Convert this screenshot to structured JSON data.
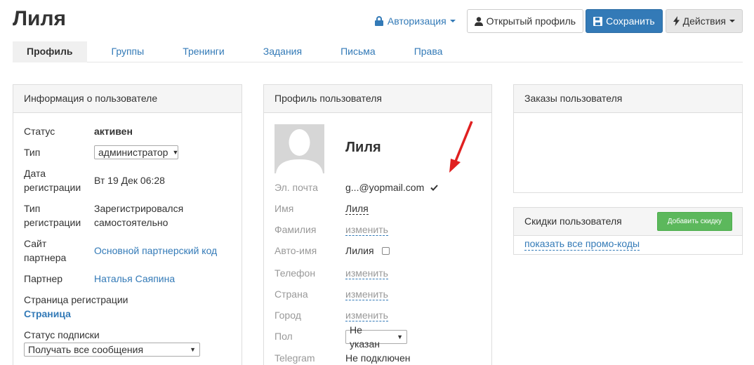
{
  "header": {
    "title": "Лиля",
    "auth_label": "Авторизация",
    "open_profile_label": "Открытый профиль",
    "save_label": "Сохранить",
    "actions_label": "Действия"
  },
  "tabs": [
    {
      "label": "Профиль",
      "active": true
    },
    {
      "label": "Группы"
    },
    {
      "label": "Тренинги"
    },
    {
      "label": "Задания"
    },
    {
      "label": "Письма"
    },
    {
      "label": "Права"
    }
  ],
  "user_info": {
    "heading": "Информация о пользователе",
    "status_label": "Статус",
    "status_value": "активен",
    "type_label": "Тип",
    "type_value": "администратор",
    "reg_date_label": "Дата регистрации",
    "reg_date_value": "Вт 19 Дек 06:28",
    "reg_type_label": "Тип регистрации",
    "reg_type_value": "Зарегистрировался самостоятельно",
    "partner_site_label": "Сайт партнера",
    "partner_site_value": "Основной партнерский код",
    "partner_label": "Партнер",
    "partner_value": "Наталья Саяпина",
    "reg_page_label": "Страница регистрации",
    "reg_page_value": "Страница",
    "subscription_label": "Статус подписки",
    "subscription_value": "Получать все сообщения"
  },
  "profile": {
    "heading": "Профиль пользователя",
    "name": "Лиля",
    "email_label": "Эл. почта",
    "email_value": "g...@yopmail.com",
    "first_name_label": "Имя",
    "first_name_value": "Лиля",
    "last_name_label": "Фамилия",
    "last_name_value": "изменить",
    "auto_name_label": "Авто-имя",
    "auto_name_value": "Лилия",
    "phone_label": "Телефон",
    "phone_value": "изменить",
    "country_label": "Страна",
    "country_value": "изменить",
    "city_label": "Город",
    "city_value": "изменить",
    "gender_label": "Пол",
    "gender_value": "Не указан",
    "telegram_label": "Telegram",
    "telegram_value": "Не подключен"
  },
  "orders": {
    "heading": "Заказы пользователя"
  },
  "discounts": {
    "heading": "Скидки пользователя",
    "add_label": "Добавить скидку",
    "promo_link": "показать все промо-коды"
  },
  "icons": {
    "lock": "lock-icon",
    "user": "user-icon",
    "save": "floppy-icon",
    "bolt": "bolt-icon",
    "check": "check-icon",
    "arrow": "red-arrow-annotation"
  },
  "colors": {
    "primary": "#337ab7",
    "success": "#5cb85c",
    "annotation": "#e02020"
  }
}
